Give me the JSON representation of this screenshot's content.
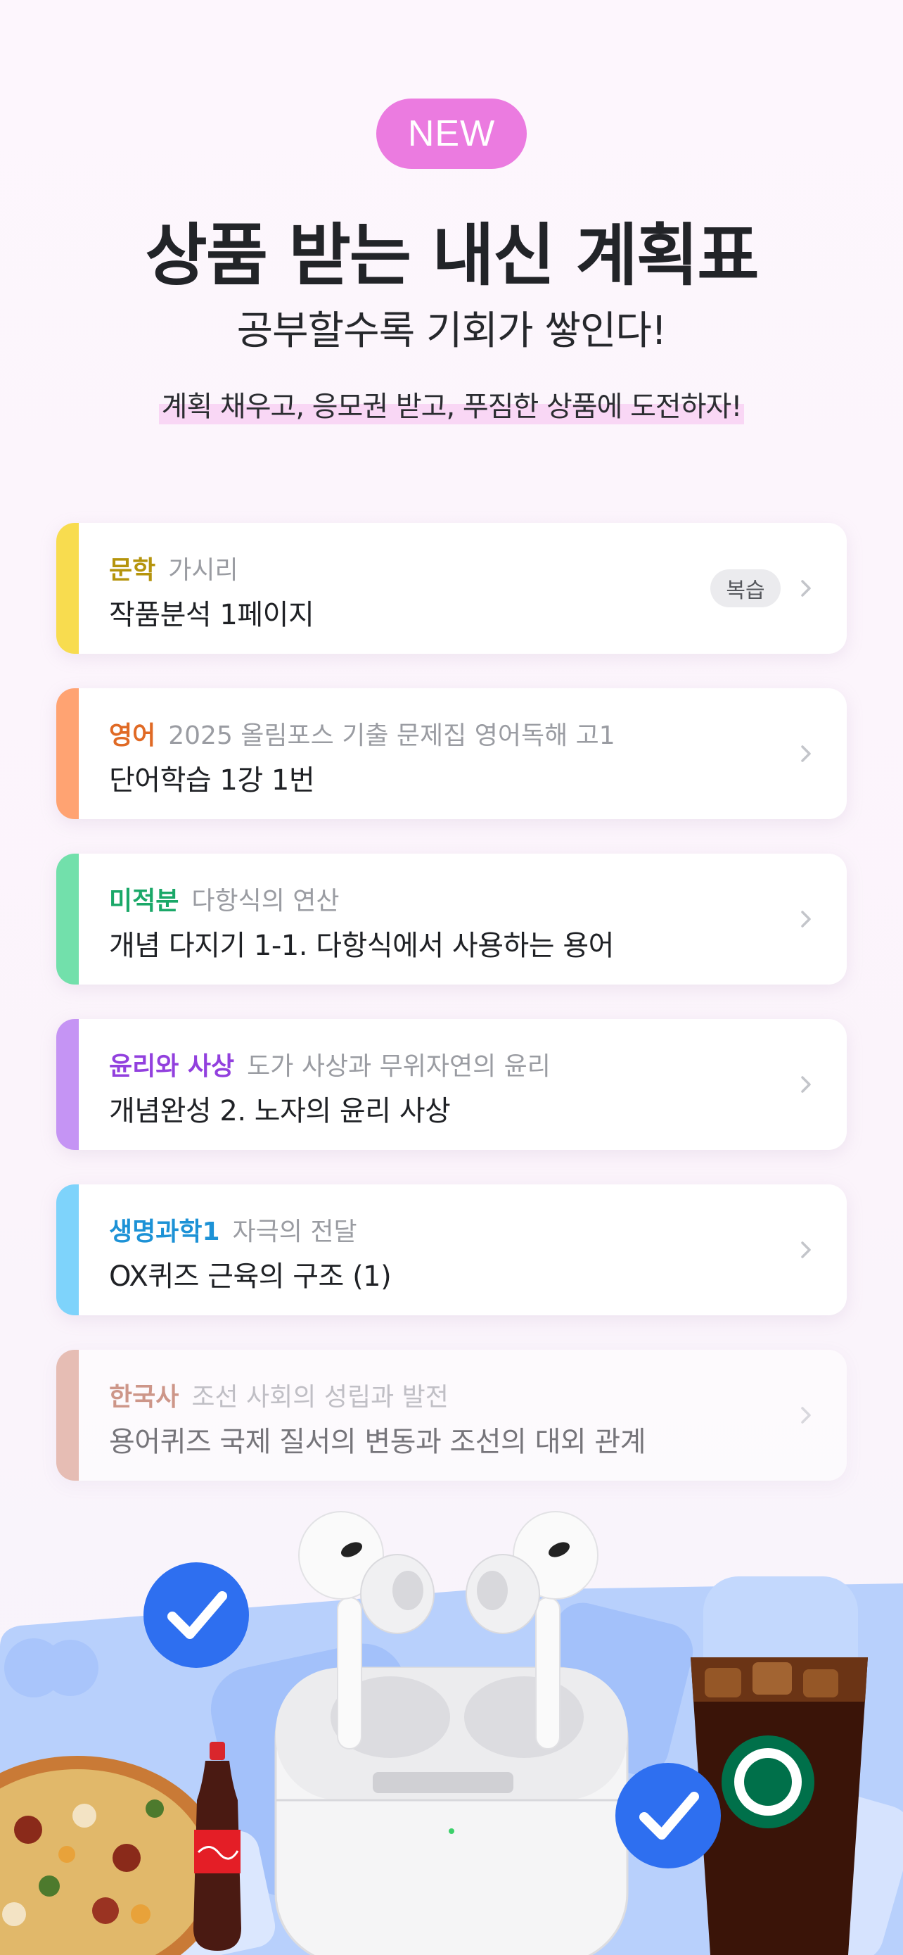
{
  "header": {
    "badge": "NEW",
    "title": "상품 받는 내신 계획표",
    "subtitle": "공부할수록 기회가 쌓인다!",
    "description": "계획 채우고, 응모권 받고, 푸짐한 상품에 도전하자!"
  },
  "plans": [
    {
      "subject": "문학",
      "topic": "가시리",
      "task": "작품분석 1페이지",
      "badge": "복습",
      "accent": "#f8dc4f",
      "subject_color": "#b5940c"
    },
    {
      "subject": "영어",
      "topic": "2025 올림포스 기출 문제집 영어독해 고1",
      "task": "단어학습 1강 1번",
      "badge": "",
      "accent": "#ffa372",
      "subject_color": "#e06a25"
    },
    {
      "subject": "미적분",
      "topic": "다항식의 연산",
      "task": "개념 다지기 1-1. 다항식에서 사용하는 용어",
      "badge": "",
      "accent": "#72e0ab",
      "subject_color": "#1aa868"
    },
    {
      "subject": "윤리와 사상",
      "topic": "도가 사상과 무위자연의 윤리",
      "task": "개념완성 2. 노자의 윤리 사상",
      "badge": "",
      "accent": "#c594f4",
      "subject_color": "#9240de"
    },
    {
      "subject": "생명과학1",
      "topic": "자극의 전달",
      "task": "OX퀴즈 근육의 구조 (1)",
      "badge": "",
      "accent": "#7ed3fb",
      "subject_color": "#1d92d6"
    },
    {
      "subject": "한국사",
      "topic": "조선 사회의 성립과 발전",
      "task": "용어퀴즈 국제 질서의 변동과 조선의 대외 관계",
      "badge": "",
      "accent": "#d99a85",
      "subject_color": "#b0583e"
    }
  ],
  "icons": {
    "chevron": "chevron-right-icon",
    "check": "check-circle-icon"
  },
  "colors": {
    "badge_bg": "#eb7be0",
    "highlight": "#f9d7f5",
    "check_bg": "#2e6ff0",
    "shape_blue": "#a9c5fb"
  }
}
